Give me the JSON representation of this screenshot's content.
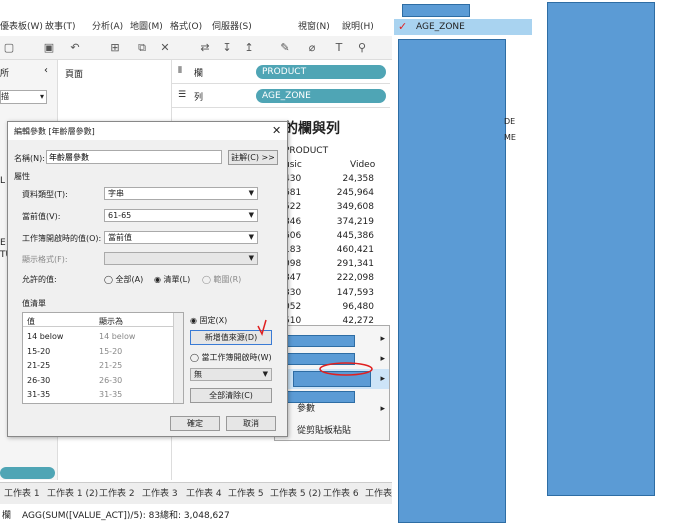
{
  "menu": [
    "優表板(W)",
    "故事(T)",
    "分析(A)",
    "地圖(M)",
    "格式(O)",
    "伺服器(S)",
    "視窗(N)",
    "說明(H)"
  ],
  "left": {
    "label1": "所",
    "label2": "描",
    "letter1": "L",
    "letter2": "E",
    "letter3": "TU"
  },
  "pages_label": "頁面",
  "shelves": {
    "cols_label": "欄",
    "cols_pill": "PRODUCT",
    "rows_label": "列",
    "rows_pill": "AGE_ZONE"
  },
  "sheet": {
    "title": "的欄與列",
    "header": "PRODUCT",
    "col1": "usic",
    "col2": "Video",
    "rows": [
      [
        "430",
        "24,358"
      ],
      [
        "681",
        "245,964"
      ],
      [
        "522",
        "349,608"
      ],
      [
        "846",
        "374,219"
      ],
      [
        "606",
        "445,386"
      ],
      [
        "183",
        "460,421"
      ],
      [
        "098",
        "291,341"
      ],
      [
        "847",
        "222,098"
      ],
      [
        "330",
        "147,593"
      ],
      [
        "052",
        "96,480"
      ],
      [
        "510",
        "42,272"
      ]
    ]
  },
  "dialog": {
    "title": "編輯參數 [年齡層參數]",
    "name_label": "名稱(N):",
    "name_value": "年齡層參數",
    "comment_btn": "註解(C) >>",
    "props_label": "屬性",
    "dtype_label": "資料類型(T):",
    "dtype_value": "字串",
    "cur_label": "當前值(V):",
    "cur_value": "61-65",
    "open_label": "工作簿開啟時的值(O):",
    "open_value": "當前值",
    "fmt_label": "顯示格式(F):",
    "allow_label": "允許的值:",
    "opt_all": "全部(A)",
    "opt_list": "清單(L)",
    "opt_range": "範圍(R)",
    "list_label": "值清單",
    "col_value": "值",
    "col_display": "顯示為",
    "list_rows": [
      [
        "14 below",
        "14 below"
      ],
      [
        "15-20",
        "15-20"
      ],
      [
        "21-25",
        "21-25"
      ],
      [
        "26-30",
        "26-30"
      ],
      [
        "31-35",
        "31-35"
      ]
    ],
    "fixed": "固定(X)",
    "add_source": "新增值來源(D)",
    "when_open": "當工作簿開啟時(W)",
    "dropdown_value": "無",
    "clear_all": "全部清除(C)",
    "ok": "確定",
    "cancel": "取消"
  },
  "context": {
    "params": "參數",
    "paste": "從剪貼板粘貼"
  },
  "tabs": [
    "工作表 1",
    "工作表 1 (2)",
    "工作表 2",
    "工作表 3",
    "工作表 4",
    "工作表 5",
    "工作表 5 (2)",
    "工作表 6",
    "工作表"
  ],
  "status": {
    "text": "AGG(SUM([VALUE_ACT])/5): 83總和: 3,048,627",
    "left": "欄"
  },
  "right": {
    "field": "AGE_ZONE",
    "frag1": "DE",
    "frag2": "ME"
  }
}
